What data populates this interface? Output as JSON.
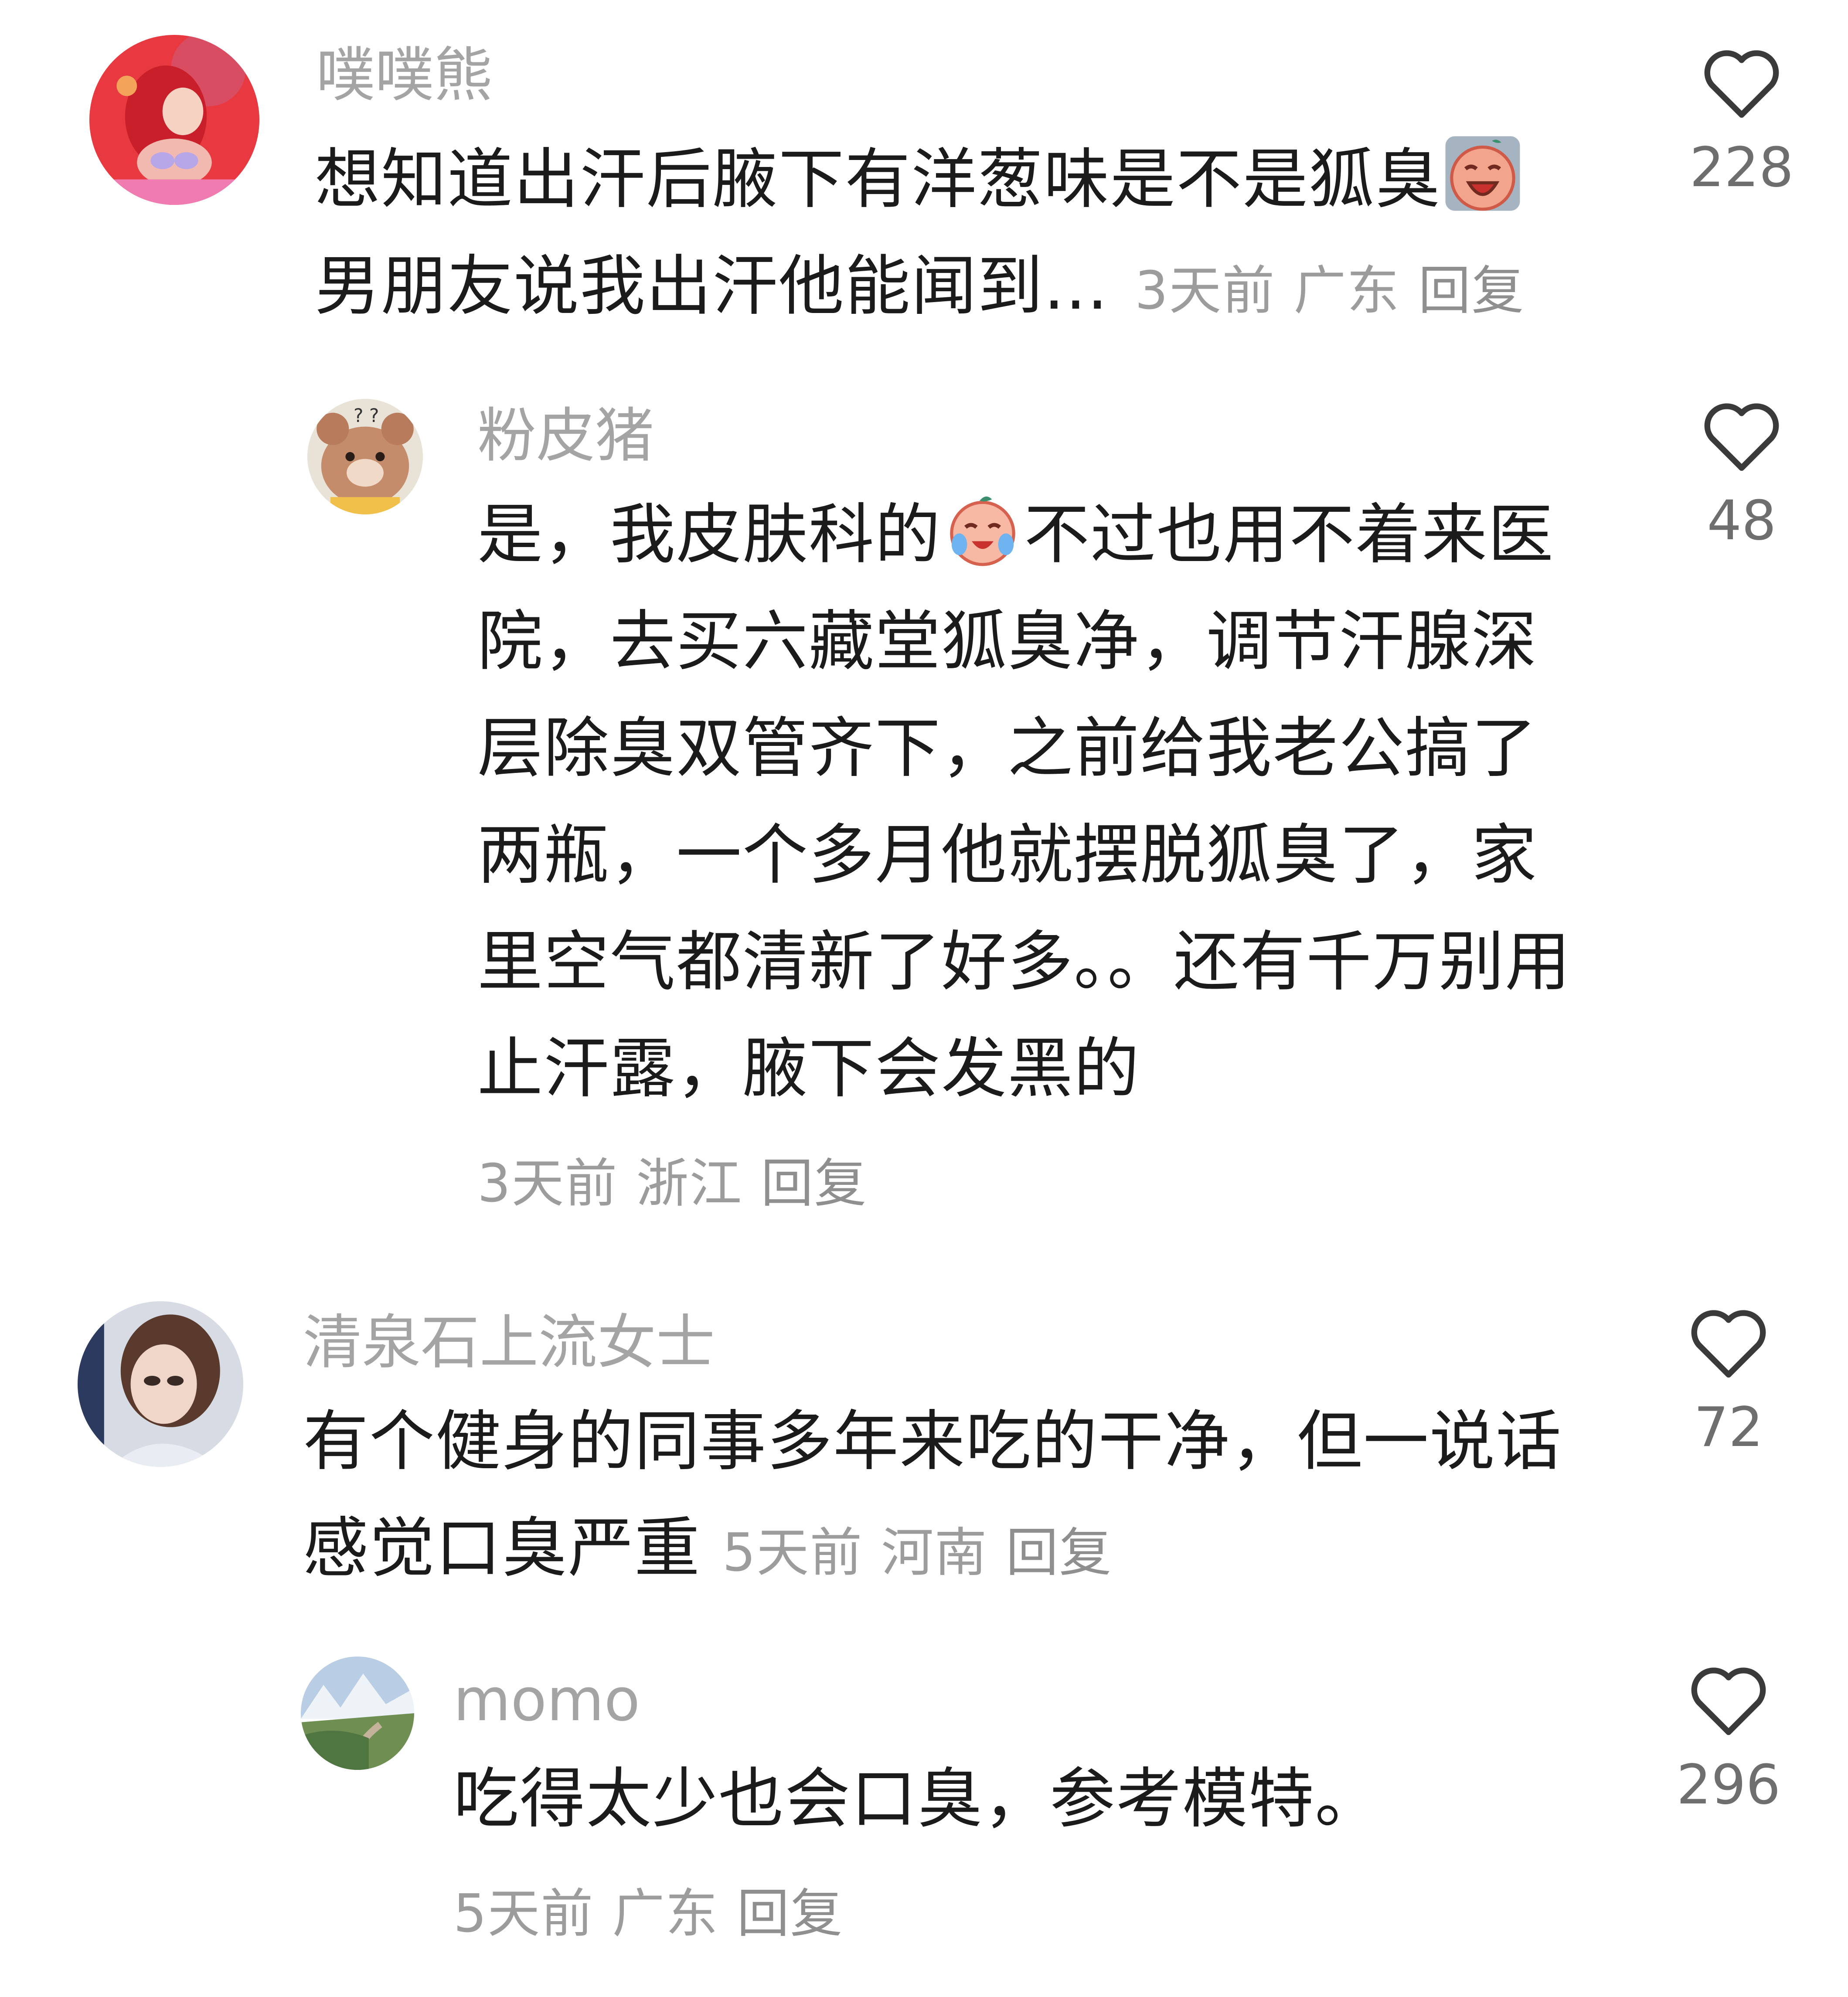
{
  "comments": [
    {
      "username": "噗噗熊",
      "text_line1": "想知道出汗后腋下有洋葱味是不是狐臭",
      "text_line2": "男朋友说我出汗他能闻到...",
      "emoji": "crying-face-emoji",
      "time": "3天前",
      "location": "广东",
      "reply_label": "回复",
      "likes": "228",
      "heart_icon": "heart-outline-icon"
    },
    {
      "username": "粉皮猪",
      "text_before_emoji": "是，我皮肤科的",
      "emoji": "crying-tears-emoji",
      "text_after_emoji": "不过也用不着来医院，去买六藏堂狐臭净，调节汗腺深层除臭双管齐下，之前给我老公搞了两瓶，一个多月他就摆脱狐臭了，家里空气都清新了好多。。还有千万别用止汗露，腋下会发黑的",
      "time": "3天前",
      "location": "浙江",
      "reply_label": "回复",
      "likes": "48"
    },
    {
      "username": "清泉石上流女士",
      "text": "有个健身的同事多年来吃的干净，但一说话感觉口臭严重",
      "time": "5天前",
      "location": "河南",
      "reply_label": "回复",
      "likes": "72"
    },
    {
      "username": "momo",
      "text": "吃得太少也会口臭，参考模特。",
      "time": "5天前",
      "location": "广东",
      "reply_label": "回复",
      "likes": "296"
    }
  ],
  "colors": {
    "username": "#a4a4a4",
    "body_text": "#1b1b1b",
    "meta": "#9c9c9c",
    "heart_stroke": "#3a3a3a",
    "like_count": "#6e6e6e"
  }
}
